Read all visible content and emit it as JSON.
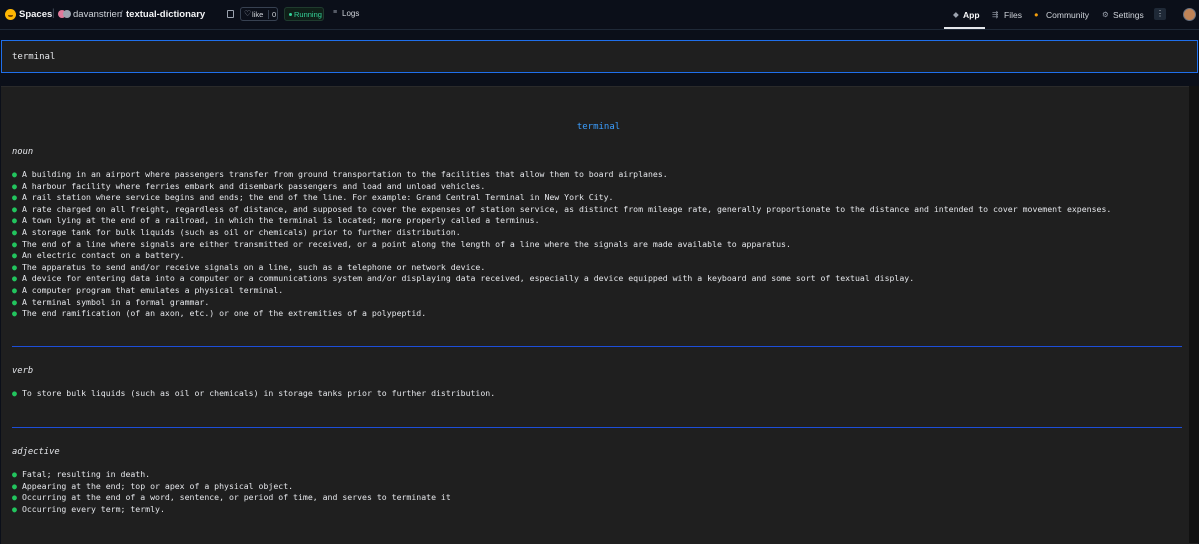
{
  "header": {
    "spaces_label": "Spaces",
    "owner": "davanstrien",
    "slash": "/",
    "repo": "textual-dictionary",
    "like_label": "like",
    "like_count": "0",
    "status": "Running",
    "logs_label": "Logs",
    "nav": {
      "app": "App",
      "files": "Files",
      "community": "Community",
      "settings": "Settings"
    },
    "more": "⋮"
  },
  "search": {
    "value": "terminal"
  },
  "result": {
    "word": "terminal",
    "sections": [
      {
        "pos": "noun",
        "definitions": [
          "A building in an airport where passengers transfer from ground transportation to the facilities that allow them to board airplanes.",
          "A harbour facility where ferries embark and disembark passengers and load and unload vehicles.",
          "A rail station where service begins and ends; the end of the line. For example: Grand Central Terminal in New York City.",
          "A rate charged on all freight, regardless of distance, and supposed to cover the expenses of station service, as distinct from mileage rate, generally proportionate to the distance and intended to cover movement expenses.",
          "A town lying at the end of a railroad, in which the terminal is located; more properly called a terminus.",
          "A storage tank for bulk liquids (such as oil or chemicals) prior to further distribution.",
          "The end of a line where signals are either transmitted or received, or a point along the length of a line where the signals are made available to apparatus.",
          "An electric contact on a battery.",
          "The apparatus to send and/or receive signals on a line, such as a telephone or network device.",
          "A device for entering data into a computer or a communications system and/or displaying data received, especially a device equipped with a keyboard and some sort of textual display.",
          "A computer program that emulates a physical terminal.",
          "A terminal symbol in a formal grammar.",
          "The end ramification (of an axon, etc.) or one of the extremities of a polypeptid."
        ]
      },
      {
        "pos": "verb",
        "definitions": [
          "To store bulk liquids (such as oil or chemicals) in storage tanks prior to further distribution."
        ]
      },
      {
        "pos": "adjective",
        "definitions": [
          "Fatal; resulting in death.",
          "Appearing at the end; top or apex of a physical object.",
          "Occurring at the end of a word, sentence, or period of time, and serves to terminate it",
          "Occurring every term; termly."
        ]
      }
    ]
  }
}
